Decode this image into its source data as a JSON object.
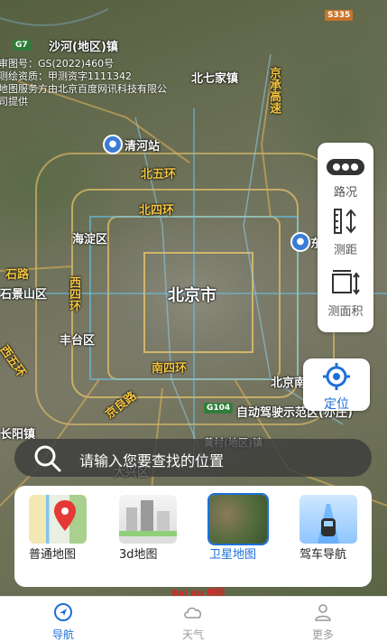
{
  "map": {
    "credit_lines": [
      "审图号：GS(2022)460号",
      "测绘资质：甲测资字1111342",
      "地图服务方由北京百度网讯科技有限公",
      "司提供"
    ],
    "shields": {
      "g7": "G7",
      "s335": "S335",
      "g104": "G104"
    },
    "labels": {
      "shahe": "沙河(地区)镇",
      "beiqijia": "北七家镇",
      "jingcheng": "京承高速",
      "qinghe_station": "清河站",
      "ring5_north": "北五环",
      "ring4_north": "北四环",
      "haidian": "海淀区",
      "shijingshan_road": "石路",
      "shijingshan": "石景山区",
      "west_ring4": "西四环",
      "beijing_city": "北京市",
      "fengtai": "丰台区",
      "west_ring5": "西五环",
      "south_ring4": "南四环",
      "jingliang": "京良路",
      "changyang": "长阳镇",
      "yizhuang": "自动驾驶示范区(亦庄)",
      "beijing_south": "北京南",
      "daxing_town": "黄村(地区)镇",
      "daxing": "大兴区",
      "east_poi": "东"
    }
  },
  "tools": {
    "traffic": "路况",
    "measure_distance": "测距",
    "measure_area": "测面积"
  },
  "locate_label": "定位",
  "search": {
    "placeholder": "请输入您要查找的位置"
  },
  "modes": [
    {
      "name": "普通地图",
      "selected": false
    },
    {
      "name": "3d地图",
      "selected": false
    },
    {
      "name": "卫星地图",
      "selected": true
    },
    {
      "name": "驾车导航",
      "selected": false
    }
  ],
  "brand": "Bai du 地图",
  "tabs": [
    {
      "label": "导航",
      "selected": true,
      "icon": "navigation-icon"
    },
    {
      "label": "天气",
      "selected": false,
      "icon": "cloud-icon"
    },
    {
      "label": "更多",
      "selected": false,
      "icon": "person-icon"
    }
  ],
  "colors": {
    "accent": "#1e6fd9",
    "ring_road": "#f4c542",
    "metro": "#6ac3e8"
  }
}
